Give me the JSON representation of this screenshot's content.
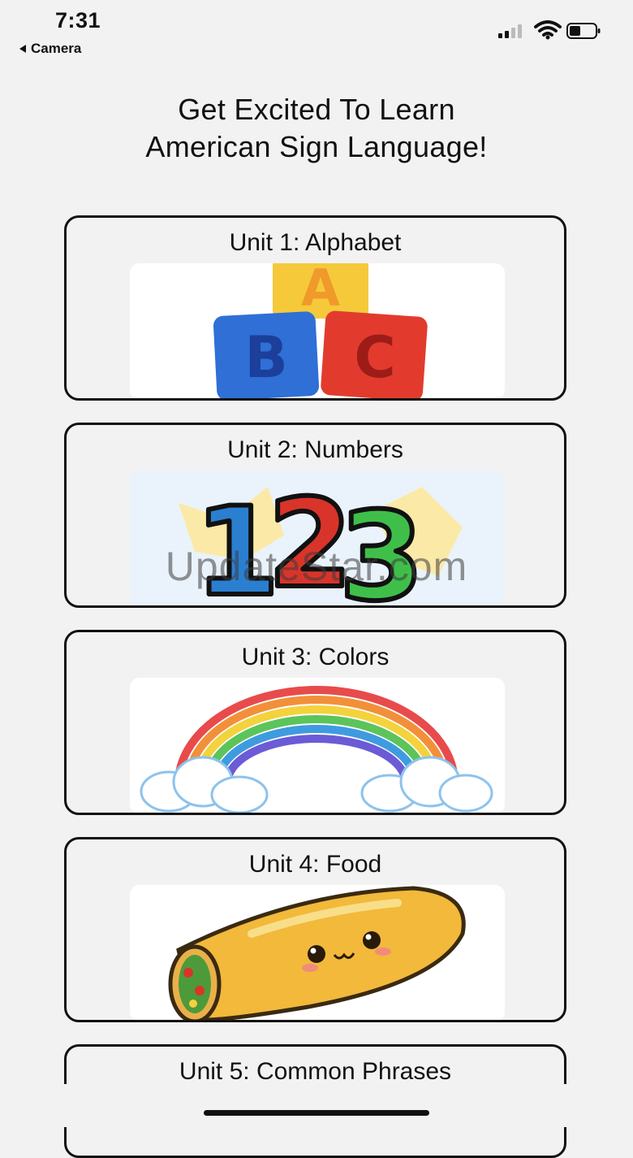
{
  "status_bar": {
    "time": "7:31",
    "back_label": "Camera",
    "back_icon": "back-triangle-icon",
    "signal_icon": "cellular-signal-icon",
    "wifi_icon": "wifi-icon",
    "battery_icon": "battery-icon"
  },
  "header": {
    "line1": "Get Excited To Learn",
    "line2": "American Sign Language!"
  },
  "units": [
    {
      "label": "Unit 1: Alphabet",
      "image": "abc-blocks-image"
    },
    {
      "label": "Unit 2: Numbers",
      "image": "numbers-123-image"
    },
    {
      "label": "Unit 3: Colors",
      "image": "rainbow-image"
    },
    {
      "label": "Unit 4: Food",
      "image": "burrito-image"
    },
    {
      "label": "Unit 5: Common Phrases",
      "image": ""
    }
  ],
  "watermark": "UpdateStar.com",
  "colors": {
    "background": "#f2f2f2",
    "card_border": "#111111",
    "block_a": "#f5c93a",
    "block_b": "#2f6fd6",
    "block_c": "#e23b2e"
  }
}
